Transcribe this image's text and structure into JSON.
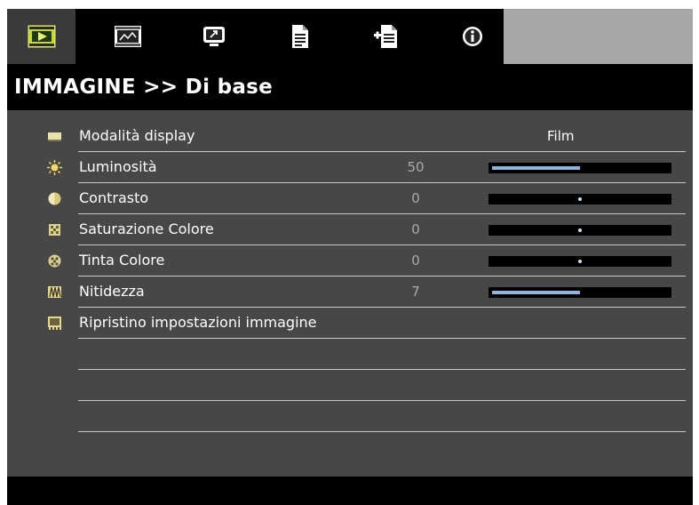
{
  "colors": {
    "background": "#474747",
    "bar": "#000000",
    "active_tab": "#3a3a3a",
    "slider_fill": "#8fb3dd",
    "divider": "#c9c9c9"
  },
  "tabs": [
    {
      "icon": "picture-tab-icon",
      "active": true
    },
    {
      "icon": "display-tab-icon",
      "active": false
    },
    {
      "icon": "setup-tab-icon",
      "active": false
    },
    {
      "icon": "options-tab-icon",
      "active": false
    },
    {
      "icon": "advanced-options-tab-icon",
      "active": false
    },
    {
      "icon": "info-tab-icon",
      "active": false
    }
  ],
  "header": {
    "title": "IMMAGINE >> Di base"
  },
  "menu": {
    "items": [
      {
        "icon": "display-mode-icon",
        "label": "Modalità display",
        "value": "Film"
      },
      {
        "icon": "brightness-icon",
        "label": "Luminosità",
        "value": "50",
        "slider": {
          "type": "bar",
          "level": 0.5
        }
      },
      {
        "icon": "contrast-icon",
        "label": "Contrasto",
        "value": "0",
        "slider": {
          "type": "center",
          "level": 0.5
        }
      },
      {
        "icon": "color-saturation-icon",
        "label": "Saturazione Colore",
        "value": "0",
        "slider": {
          "type": "center",
          "level": 0.5
        }
      },
      {
        "icon": "tint-icon",
        "label": "Tinta Colore",
        "value": "0",
        "slider": {
          "type": "center",
          "level": 0.5
        }
      },
      {
        "icon": "sharpness-icon",
        "label": "Nitidezza",
        "value": "7",
        "slider": {
          "type": "bar",
          "level": 0.5
        }
      },
      {
        "icon": "reset-icon",
        "label": "Ripristino impostazioni immagine"
      }
    ]
  }
}
